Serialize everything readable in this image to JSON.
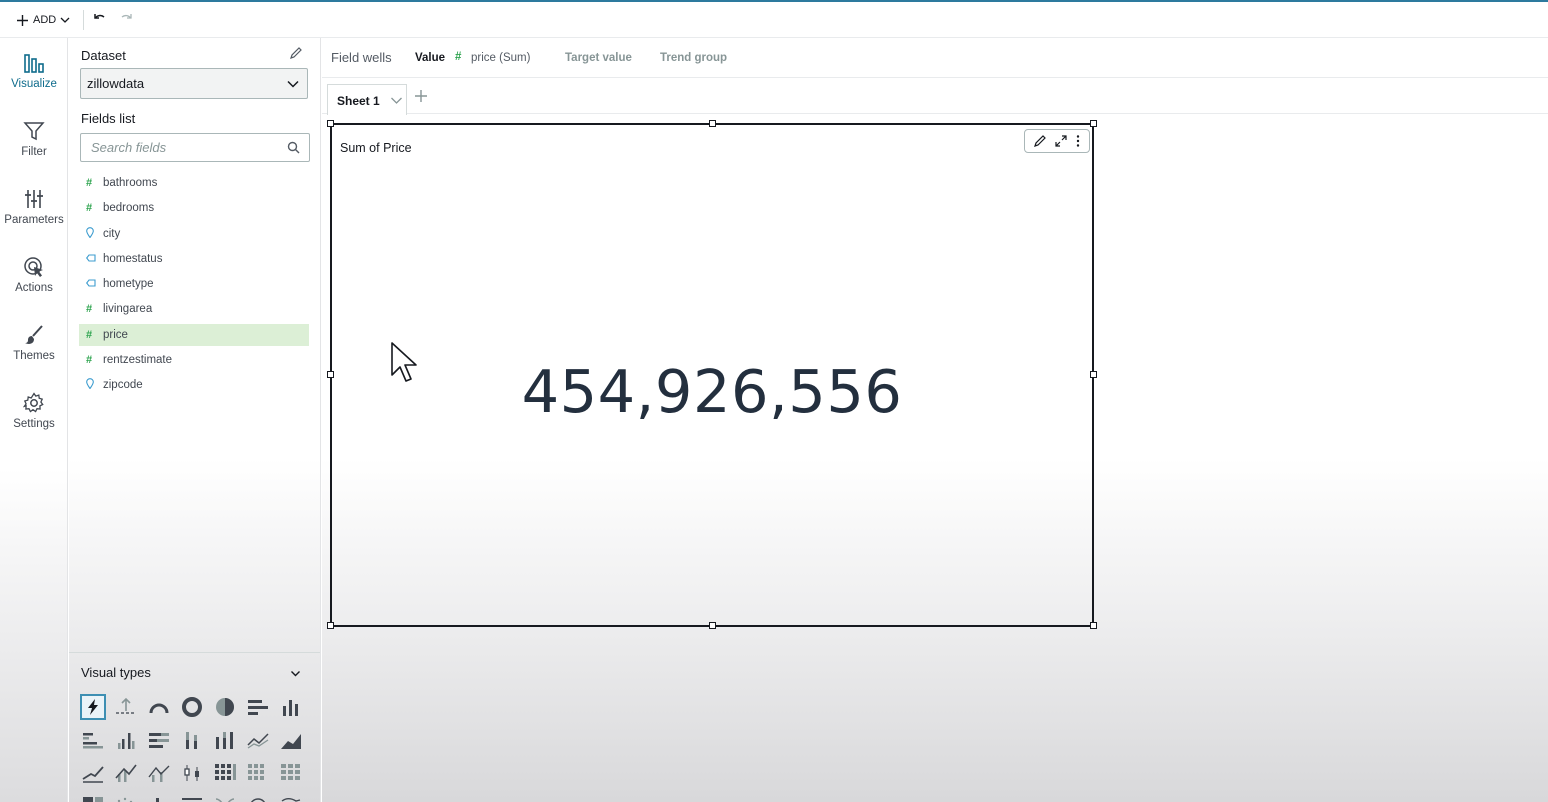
{
  "toolbar": {
    "add_label": "ADD"
  },
  "rail": {
    "items": [
      {
        "label": "Visualize",
        "icon": "bar-chart-icon",
        "active": true
      },
      {
        "label": "Filter",
        "icon": "filter-icon"
      },
      {
        "label": "Parameters",
        "icon": "sliders-icon"
      },
      {
        "label": "Actions",
        "icon": "actions-cursor-icon"
      },
      {
        "label": "Themes",
        "icon": "brush-icon"
      },
      {
        "label": "Settings",
        "icon": "gear-icon"
      }
    ]
  },
  "dataset": {
    "label": "Dataset",
    "selected": "zillowdata"
  },
  "fields": {
    "label": "Fields list",
    "search_placeholder": "Search fields",
    "items": [
      {
        "name": "bathrooms",
        "type": "number"
      },
      {
        "name": "bedrooms",
        "type": "number"
      },
      {
        "name": "city",
        "type": "geo"
      },
      {
        "name": "homestatus",
        "type": "dimension"
      },
      {
        "name": "hometype",
        "type": "dimension"
      },
      {
        "name": "livingarea",
        "type": "number"
      },
      {
        "name": "price",
        "type": "number",
        "selected": true
      },
      {
        "name": "rentzestimate",
        "type": "number"
      },
      {
        "name": "zipcode",
        "type": "geo"
      }
    ]
  },
  "visual_types": {
    "label": "Visual types",
    "selected_icon": "kpi-icon"
  },
  "field_wells": {
    "label": "Field wells",
    "value_label": "Value",
    "value_field": "price (Sum)",
    "target_label": "Target value",
    "trend_label": "Trend group"
  },
  "sheet": {
    "tab_label": "Sheet 1"
  },
  "visual": {
    "title": "Sum of Price",
    "kpi_value": "454,926,556"
  },
  "colors": {
    "accent": "#0f6c8c",
    "number_field": "#2ea44f",
    "geo_field": "#3c9ccf",
    "selected_field_bg": "#dcefd6"
  }
}
